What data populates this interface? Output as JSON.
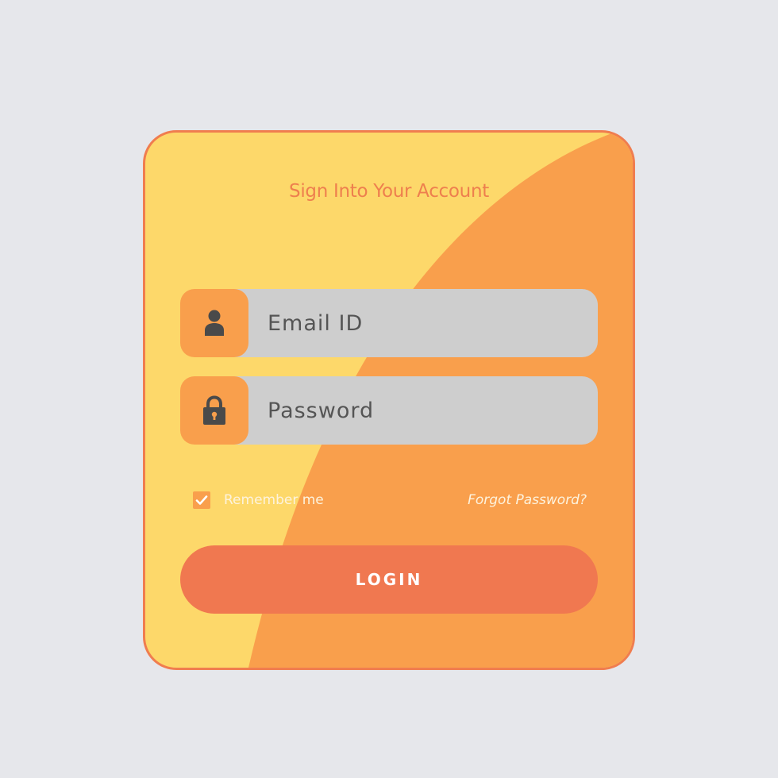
{
  "colors": {
    "page_background": "#e6e7eb",
    "card_yellow": "#fdd86a",
    "card_orange": "#f99f4c",
    "card_border": "#f07d4f",
    "accent_coral": "#f07850",
    "input_gray": "#cecece",
    "icon_dark": "#4a4a4a"
  },
  "login_card": {
    "title": "Sign Into Your Account",
    "email_field": {
      "icon": "user-icon",
      "placeholder": "Email ID",
      "value": ""
    },
    "password_field": {
      "icon": "lock-icon",
      "placeholder": "Password",
      "value": ""
    },
    "remember_me": {
      "label": "Remember me",
      "checked": true
    },
    "forgot_password_label": "Forgot Password?",
    "login_button_label": "LOGIN"
  }
}
